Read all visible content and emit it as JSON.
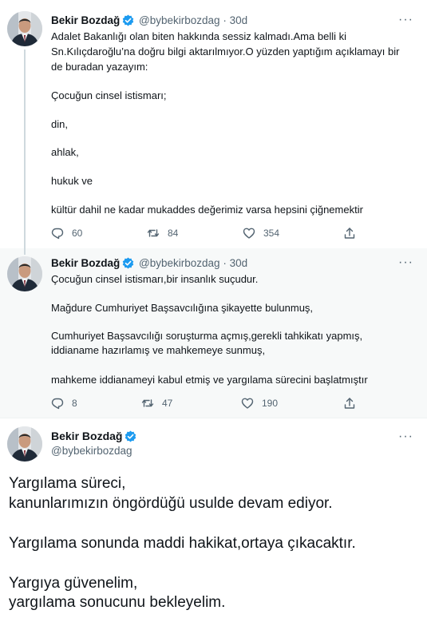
{
  "colors": {
    "verified": "#1d9bf0",
    "secondary_text": "#536471",
    "highlight_bg": "#f7f9f9"
  },
  "tweets": [
    {
      "name": "Bekir Bozdağ",
      "handle": "@bybekirbozdag",
      "time": "· 30d",
      "more_icon": "···",
      "lines": [
        "Adalet Bakanlığı olan biten hakkında sessiz kalmadı.Ama belli ki",
        "Sn.Kılıçdaroğlu’na doğru bilgi aktarılmıyor.O yüzden yaptığım açıklamayı bir",
        "de buradan yazayım:",
        "Çocuğun cinsel istismarı;",
        "din,",
        "ahlak,",
        "hukuk ve",
        "kültür dahil ne kadar mukaddes değerimiz varsa hepsini çiğnemektir"
      ],
      "replies": "60",
      "retweets": "84",
      "likes": "354"
    },
    {
      "name": "Bekir Bozdağ",
      "handle": "@bybekirbozdag",
      "time": "· 30d",
      "more_icon": "···",
      "lines": [
        "Çocuğun cinsel istismarı,bir insanlık suçudur.",
        "Mağdure Cumhuriyet Başsavcılığına şikayette bulunmuş,",
        "Cumhuriyet Başsavcılığı soruşturma açmış,gerekli tahkikatı yapmış,",
        "iddianame hazırlamış ve mahkemeye sunmuş,",
        "mahkeme iddianameyi kabul etmiş ve yargılama sürecini başlatmıştır"
      ],
      "replies": "8",
      "retweets": "47",
      "likes": "190"
    },
    {
      "name": "Bekir Bozdağ",
      "handle": "@bybekirbozdag",
      "more_icon": "···",
      "lines": [
        "Yargılama süreci,",
        "kanunlarımızın öngördüğü usulde devam ediyor.",
        "Yargılama sonunda maddi hakikat,ortaya çıkacaktır.",
        "Yargıya güvenelim,",
        "yargılama sonucunu bekleyelim."
      ]
    }
  ]
}
